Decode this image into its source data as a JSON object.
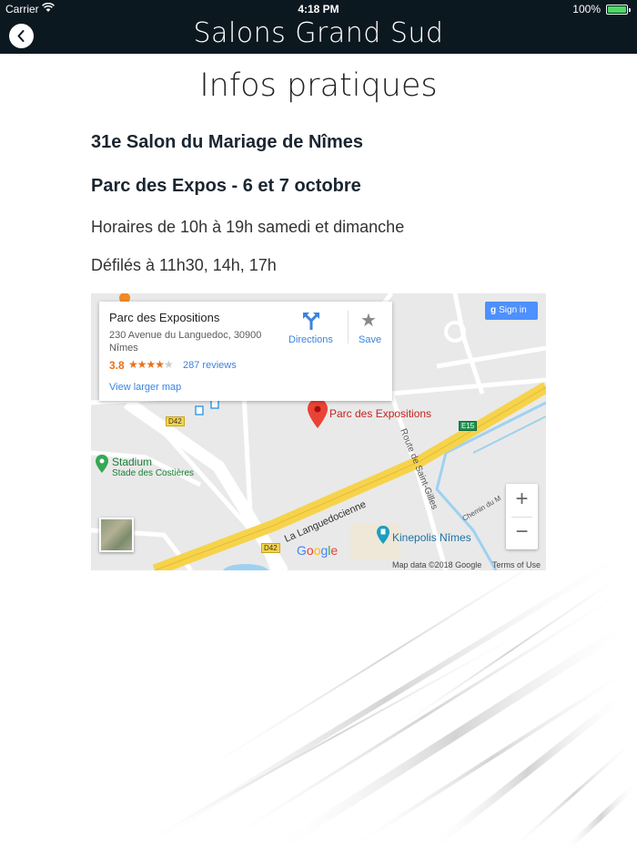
{
  "status_bar": {
    "carrier": "Carrier",
    "time": "4:18 PM",
    "battery": "100%"
  },
  "nav": {
    "title": "Salons Grand Sud",
    "back_icon": "chevron-left-icon"
  },
  "page": {
    "title": "Infos pratiques",
    "event": "31e Salon du Mariage de Nîmes",
    "venue": "Parc des Expos - 6 et 7 octobre",
    "hours": "Horaires de 10h à 19h samedi et dimanche",
    "parades": "Défilés à 11h30, 14h, 17h"
  },
  "map": {
    "place_name": "Parc des Expositions",
    "address_line1": "230 Avenue du Languedoc, 30900",
    "address_line2": "Nîmes",
    "rating": "3.8",
    "rating_stars": 3.8,
    "reviews": "287 reviews",
    "view_larger": "View larger map",
    "directions": "Directions",
    "save": "Save",
    "sign_in": "Sign in",
    "pin_label": "Parc des Expositions",
    "stadium": "Stadium",
    "stadium_sub": "Stade des Costières",
    "kinepolis": "Kinepolis Nîmes",
    "road_languedocienne": "La Languedocienne",
    "road_saint_gilles": "Route de Saint-Gilles",
    "road_chemin": "Chemin du M",
    "tag_d42": "D42",
    "tag_e15": "E15",
    "google": "Google",
    "map_data": "Map data ©2018 Google",
    "terms": "Terms of Use",
    "zoom_in": "+",
    "zoom_out": "−",
    "colors": {
      "pin": "#ea4335",
      "highway": "#f6d34b",
      "link": "#3a84df"
    }
  }
}
